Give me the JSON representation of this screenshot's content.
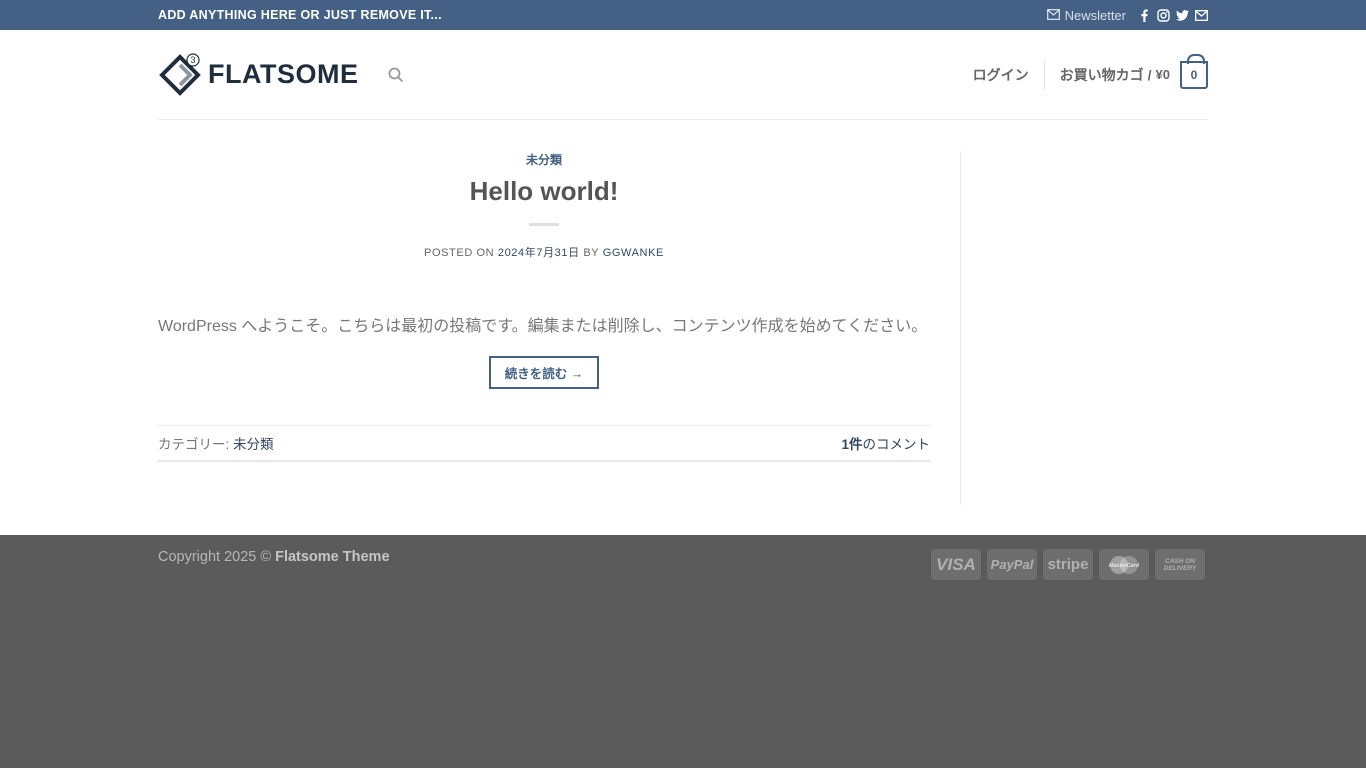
{
  "topbar": {
    "promo": "ADD ANYTHING HERE OR JUST REMOVE IT...",
    "newsletter": "Newsletter",
    "social_icons": [
      "facebook-icon",
      "instagram-icon",
      "twitter-icon",
      "email-icon"
    ]
  },
  "header": {
    "logo_text": "FLATSOME",
    "logo_badge": "3",
    "login": "ログイン",
    "cart_label": "お買い物カゴ",
    "cart_sep": "/",
    "cart_amount": "¥0",
    "cart_count": "0"
  },
  "post": {
    "category": "未分類",
    "title": "Hello world!",
    "meta_prefix": "POSTED ON",
    "date": "2024年7月31日",
    "meta_by": "BY",
    "author": "GGWANKE",
    "excerpt": "WordPress へようこそ。こちらは最初の投稿です。編集または削除し、コンテンツ作成を始めてください。",
    "read_more": "続きを読む →",
    "category_prefix": "カテゴリー:",
    "category_link": "未分類",
    "comments_count": "1件",
    "comments_label": "のコメント"
  },
  "footer": {
    "copyright_prefix": "Copyright 2025 ©",
    "theme_name": "Flatsome Theme",
    "payments": {
      "visa": "VISA",
      "paypal": "PayPal",
      "stripe": "stripe",
      "mastercard": "MasterCard",
      "cash_line1": "CASH ON",
      "cash_line2": "DELIVERY"
    }
  },
  "colors": {
    "primary": "#446084",
    "link": "#334862",
    "footer_bg": "#5b5b5b"
  }
}
